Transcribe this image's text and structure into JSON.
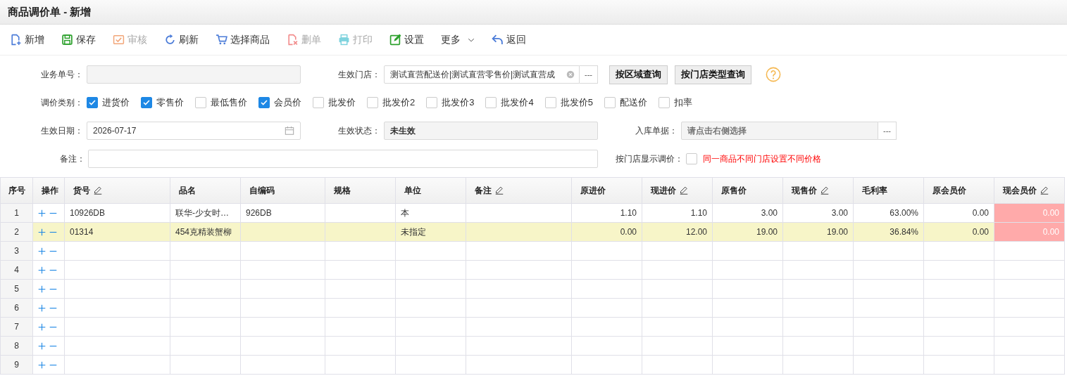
{
  "window": {
    "title": "商品调价单 - 新增"
  },
  "toolbar": [
    {
      "label": "新增",
      "kind": "button",
      "disabled": false
    },
    {
      "label": "保存",
      "kind": "button",
      "disabled": false
    },
    {
      "label": "审核",
      "kind": "button",
      "disabled": true
    },
    {
      "label": "刷新",
      "kind": "button",
      "disabled": false
    },
    {
      "label": "选择商品",
      "kind": "button",
      "disabled": false
    },
    {
      "label": "删单",
      "kind": "button",
      "disabled": true
    },
    {
      "label": "打印",
      "kind": "button",
      "disabled": true
    },
    {
      "label": "设置",
      "kind": "button",
      "disabled": false
    },
    {
      "label": "更多",
      "kind": "dropdown",
      "disabled": false
    },
    {
      "label": "返回",
      "kind": "button",
      "disabled": false
    }
  ],
  "form": {
    "order_no": {
      "label": "业务单号："
    },
    "stores": {
      "label": "生效门店：",
      "value": "测试直营配送价|测试直营零售价|测试直营成",
      "browse_button": "---"
    },
    "query_buttons": [
      "按区域查询",
      "按门店类型查询"
    ],
    "price_types": {
      "label": "调价类别：",
      "options": [
        {
          "label": "进货价",
          "checked": true
        },
        {
          "label": "零售价",
          "checked": true
        },
        {
          "label": "最低售价",
          "checked": false
        },
        {
          "label": "会员价",
          "checked": true
        },
        {
          "label": "批发价",
          "checked": false
        },
        {
          "label": "批发价2",
          "checked": false
        },
        {
          "label": "批发价3",
          "checked": false
        },
        {
          "label": "批发价4",
          "checked": false
        },
        {
          "label": "批发价5",
          "checked": false
        },
        {
          "label": "配送价",
          "checked": false
        },
        {
          "label": "扣率",
          "checked": false
        }
      ]
    },
    "effective_date": {
      "label": "生效日期：",
      "value": "2026-07-17"
    },
    "status": {
      "label": "生效状态：",
      "value": "未生效"
    },
    "receipt": {
      "label": "入库单据：",
      "placeholder": "请点击右侧选择",
      "browse_button": "---"
    },
    "remark": {
      "label": "备注："
    },
    "show_by_store": {
      "label": "按门店显示调价：",
      "checked": false,
      "note": "同一商品不同门店设置不同价格"
    }
  },
  "table": {
    "columns": [
      {
        "title": "序号",
        "editable": false,
        "flagged": false
      },
      {
        "title": "操作",
        "editable": false,
        "flagged": false
      },
      {
        "title": "货号",
        "editable": true,
        "flagged": false
      },
      {
        "title": "品名",
        "editable": false,
        "flagged": false
      },
      {
        "title": "自编码",
        "editable": false,
        "flagged": false
      },
      {
        "title": "规格",
        "editable": false,
        "flagged": false
      },
      {
        "title": "单位",
        "editable": false,
        "flagged": false
      },
      {
        "title": "备注",
        "editable": true,
        "flagged": false
      },
      {
        "title": "原进价",
        "editable": false,
        "flagged": false
      },
      {
        "title": "现进价",
        "editable": true,
        "flagged": false
      },
      {
        "title": "原售价",
        "editable": false,
        "flagged": false
      },
      {
        "title": "现售价",
        "editable": true,
        "flagged": false
      },
      {
        "title": "毛利率",
        "editable": false,
        "flagged": false
      },
      {
        "title": "原会员价",
        "editable": false,
        "flagged": false
      },
      {
        "title": "现会员价",
        "editable": true,
        "flagged": true
      }
    ],
    "rows": [
      {
        "no": "1",
        "selected": false,
        "cells": [
          "10926DB",
          "联华-少女时…",
          "926DB",
          null,
          "本",
          null,
          "1.10",
          "1.10",
          "3.00",
          "3.00",
          "63.00%",
          "0.00",
          "0.00"
        ]
      },
      {
        "no": "2",
        "selected": true,
        "cells": [
          "01314",
          "454克精装蟹柳",
          null,
          null,
          "未指定",
          null,
          "0.00",
          "12.00",
          "19.00",
          "19.00",
          "36.84%",
          "0.00",
          "0.00"
        ]
      },
      {
        "no": "3",
        "selected": false
      },
      {
        "no": "4",
        "selected": false
      },
      {
        "no": "5",
        "selected": false
      },
      {
        "no": "6",
        "selected": false
      },
      {
        "no": "7",
        "selected": false
      },
      {
        "no": "8",
        "selected": false
      },
      {
        "no": "9",
        "selected": false
      }
    ]
  }
}
